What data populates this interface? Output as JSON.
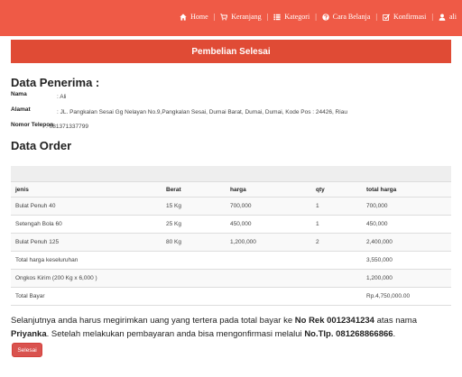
{
  "nav": {
    "items": [
      {
        "label": "Home",
        "icon": "home-icon"
      },
      {
        "label": "Keranjang",
        "icon": "cart-icon"
      },
      {
        "label": "Kategori",
        "icon": "list-icon"
      },
      {
        "label": "Cara Belanja",
        "icon": "question-icon"
      },
      {
        "label": "Konfirmasi",
        "icon": "check-icon"
      },
      {
        "label": "ali",
        "icon": "user-icon"
      }
    ],
    "separator": "|"
  },
  "banner": {
    "title": "Pembelian Selesai"
  },
  "recipient": {
    "heading": "Data Penerima :",
    "name_label": "Nama",
    "name_value": ": Ali",
    "address_label": "Alamat",
    "address_value": ": JL. Pangkalan Sesai Gg Nelayan No.9,Pangkalan Sesai, Dumai Barat, Dumai, Dumai, Kode Pos : 24426, Riau",
    "phone_label": "Nomor Telepon",
    "phone_value": ": 081371337799"
  },
  "order": {
    "heading": "Data Order",
    "headers": [
      "jenis",
      "Berat",
      "harga",
      "qty",
      "total harga"
    ],
    "rows": [
      [
        "Bulat Penuh 40",
        "15 Kg",
        "700,000",
        "1",
        "700,000"
      ],
      [
        "Setengah Bola 60",
        "25 Kg",
        "450,000",
        "1",
        "450,000"
      ],
      [
        "Bulat Penuh 125",
        "80 Kg",
        "1,200,000",
        "2",
        "2,400,000"
      ]
    ],
    "summary": [
      {
        "label": "Total harga keseluruhan",
        "value": "3,550,000"
      },
      {
        "label": "Ongkos Kirim (200 Kg x 6,000 )",
        "value": "1,200,000"
      },
      {
        "label": "Total Bayar",
        "value": "Rp.4,750,000.00"
      }
    ]
  },
  "footer": {
    "text1": "Selanjutnya anda harus megirimkan uang yang tertera pada total bayar ke ",
    "rek": "No Rek 0012341234",
    "text2": " atas nama ",
    "nama": "Priyanka",
    "text3": ". Setelah melakukan pembayaran anda bisa mengonfirmasi melalui ",
    "tlp": "No.Tlp. 081268866866",
    "text4": ".",
    "button_label": "Selesai"
  },
  "colors": {
    "topbar": "#ef5a46",
    "banner": "#e04b35",
    "button": "#d9534f"
  }
}
